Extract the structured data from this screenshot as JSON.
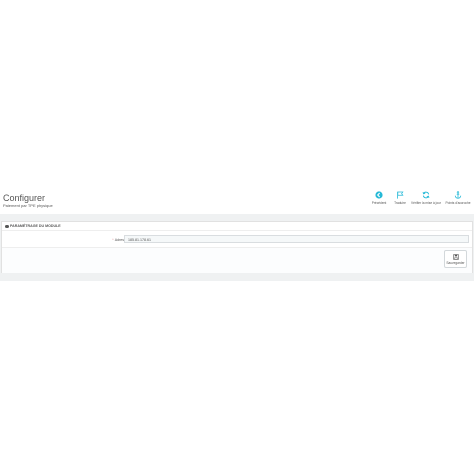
{
  "header": {
    "title": "Configurer",
    "subtitle": "Paiement par TPE physique"
  },
  "toolbar": {
    "items": [
      {
        "label": "Précédent",
        "icon": "circle-arrow-left-icon"
      },
      {
        "label": "Traduire",
        "icon": "flag-icon"
      },
      {
        "label": "Vérifier la mise à jour",
        "icon": "refresh-icon"
      },
      {
        "label": "Points d'accroche",
        "icon": "anchor-icon"
      }
    ]
  },
  "panel": {
    "heading": "PARAMÉTRAGE DU MODULE",
    "heading_icon": "gear-icon",
    "fields": [
      {
        "label": "Adresse IP autorisée",
        "required": "*",
        "value": "185.81.178.61"
      }
    ],
    "save_label": "Sauvegarder",
    "save_icon": "save-icon"
  },
  "colors": {
    "accent": "#25b9d7",
    "background_band": "#eff1f2",
    "required": "#e08f95"
  }
}
